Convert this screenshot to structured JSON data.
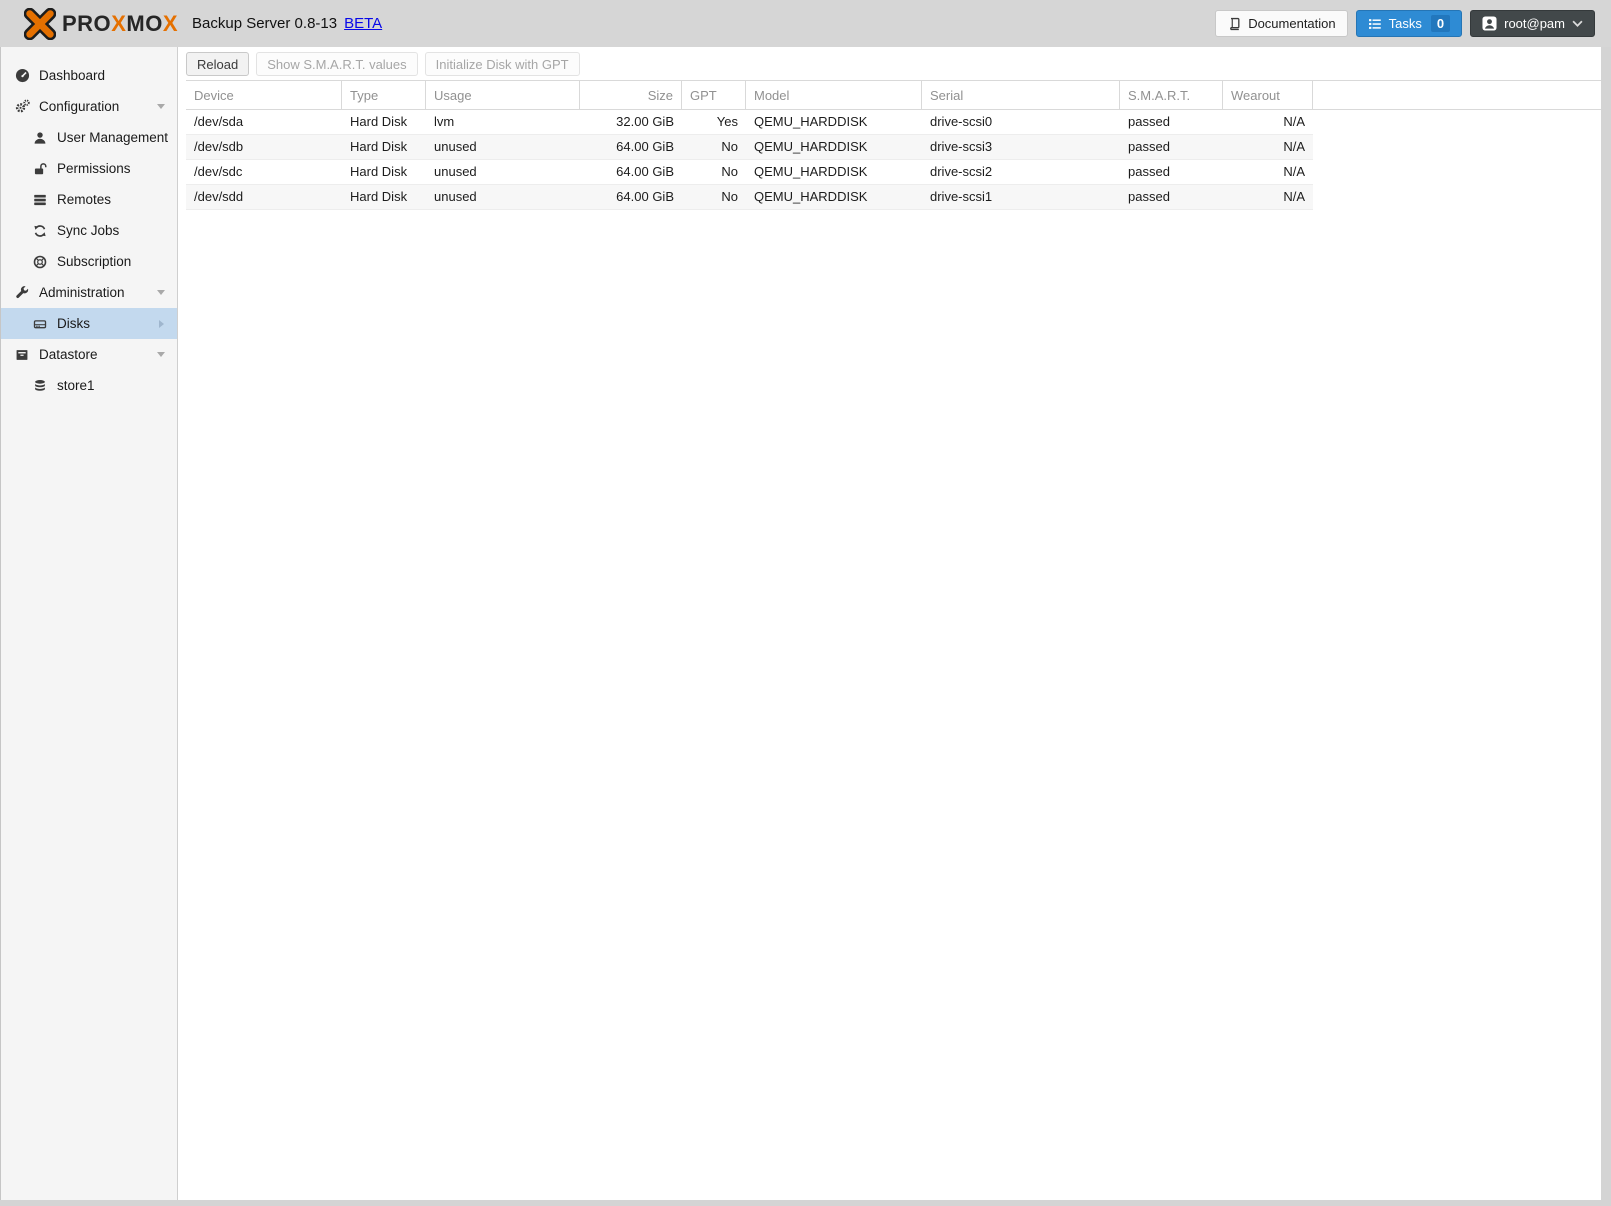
{
  "brand": {
    "logo_parts": [
      "PRO",
      "X",
      "MO",
      "X"
    ],
    "title": "Backup Server 0.8-13",
    "beta_label": "BETA"
  },
  "header": {
    "documentation_label": "Documentation",
    "tasks_label": "Tasks",
    "tasks_count": "0",
    "user_label": "root@pam"
  },
  "sidebar": {
    "items": [
      {
        "label": "Dashboard"
      },
      {
        "label": "Configuration"
      },
      {
        "label": "User Management"
      },
      {
        "label": "Permissions"
      },
      {
        "label": "Remotes"
      },
      {
        "label": "Sync Jobs"
      },
      {
        "label": "Subscription"
      },
      {
        "label": "Administration"
      },
      {
        "label": "Disks"
      },
      {
        "label": "Datastore"
      },
      {
        "label": "store1"
      }
    ]
  },
  "toolbar": {
    "reload_label": "Reload",
    "smart_label": "Show S.M.A.R.T. values",
    "gpt_label": "Initialize Disk with GPT"
  },
  "table": {
    "columns": [
      "Device",
      "Type",
      "Usage",
      "Size",
      "GPT",
      "Model",
      "Serial",
      "S.M.A.R.T.",
      "Wearout"
    ],
    "rows": [
      {
        "device": "/dev/sda",
        "type": "Hard Disk",
        "usage": "lvm",
        "size": "32.00 GiB",
        "gpt": "Yes",
        "model": "QEMU_HARDDISK",
        "serial": "drive-scsi0",
        "smart": "passed",
        "wearout": "N/A"
      },
      {
        "device": "/dev/sdb",
        "type": "Hard Disk",
        "usage": "unused",
        "size": "64.00 GiB",
        "gpt": "No",
        "model": "QEMU_HARDDISK",
        "serial": "drive-scsi3",
        "smart": "passed",
        "wearout": "N/A"
      },
      {
        "device": "/dev/sdc",
        "type": "Hard Disk",
        "usage": "unused",
        "size": "64.00 GiB",
        "gpt": "No",
        "model": "QEMU_HARDDISK",
        "serial": "drive-scsi2",
        "smart": "passed",
        "wearout": "N/A"
      },
      {
        "device": "/dev/sdd",
        "type": "Hard Disk",
        "usage": "unused",
        "size": "64.00 GiB",
        "gpt": "No",
        "model": "QEMU_HARDDISK",
        "serial": "drive-scsi1",
        "smart": "passed",
        "wearout": "N/A"
      }
    ]
  },
  "colors": {
    "accent_orange": "#e57000",
    "tasks_blue": "#2e8bd4",
    "selected_item_blue": "#c3d9ee",
    "beta_link_blue": "#0707e8",
    "user_button_gray": "#42484a"
  }
}
